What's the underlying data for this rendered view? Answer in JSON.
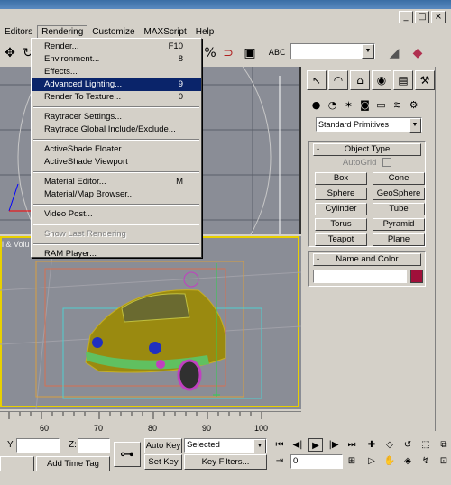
{
  "window": {
    "minimize": "_",
    "maximize": "□",
    "close": "×"
  },
  "menubar": [
    "Editors",
    "Rendering",
    "Customize",
    "MAXScript",
    "Help"
  ],
  "rendering_menu": [
    {
      "label": "Render...",
      "shortcut": "F10"
    },
    {
      "label": "Environment...",
      "shortcut": "8"
    },
    {
      "label": "Effects...",
      "shortcut": ""
    },
    {
      "label": "Advanced Lighting...",
      "shortcut": "9"
    },
    {
      "label": "Render To Texture...",
      "shortcut": "0"
    },
    {
      "label": "Raytracer Settings...",
      "shortcut": ""
    },
    {
      "label": "Raytrace Global Include/Exclude...",
      "shortcut": ""
    },
    {
      "label": "ActiveShade Floater...",
      "shortcut": ""
    },
    {
      "label": "ActiveShade Viewport",
      "shortcut": ""
    },
    {
      "label": "Material Editor...",
      "shortcut": "M"
    },
    {
      "label": "Material/Map Browser...",
      "shortcut": ""
    },
    {
      "label": "Video Post...",
      "shortcut": ""
    },
    {
      "label": "Show Last Rendering",
      "shortcut": ""
    },
    {
      "label": "RAM Player...",
      "shortcut": ""
    }
  ],
  "toolbar": {
    "abc_label": "ABC"
  },
  "viewports": {
    "bottom_label": "l & Volu"
  },
  "command_panel": {
    "category": "Standard Primitives",
    "object_type_header": "Object Type",
    "autogrid": "AutoGrid",
    "primitives": [
      "Box",
      "Cone",
      "Sphere",
      "GeoSphere",
      "Cylinder",
      "Tube",
      "Torus",
      "Pyramid",
      "Teapot",
      "Plane"
    ],
    "name_color_header": "Name and Color",
    "minus": "-",
    "color": "#a0103a"
  },
  "timeline": {
    "ticks": [
      "60",
      "70",
      "80",
      "90",
      "100"
    ]
  },
  "bottom": {
    "y_label": "Y:",
    "z_label": "Z:",
    "auto_key": "Auto Key",
    "set_key": "Set Key",
    "key_mode": "Selected",
    "key_filters": "Key Filters...",
    "add_time_tag": "Add Time Tag",
    "frame": "0",
    "key_icon": "⊶"
  }
}
